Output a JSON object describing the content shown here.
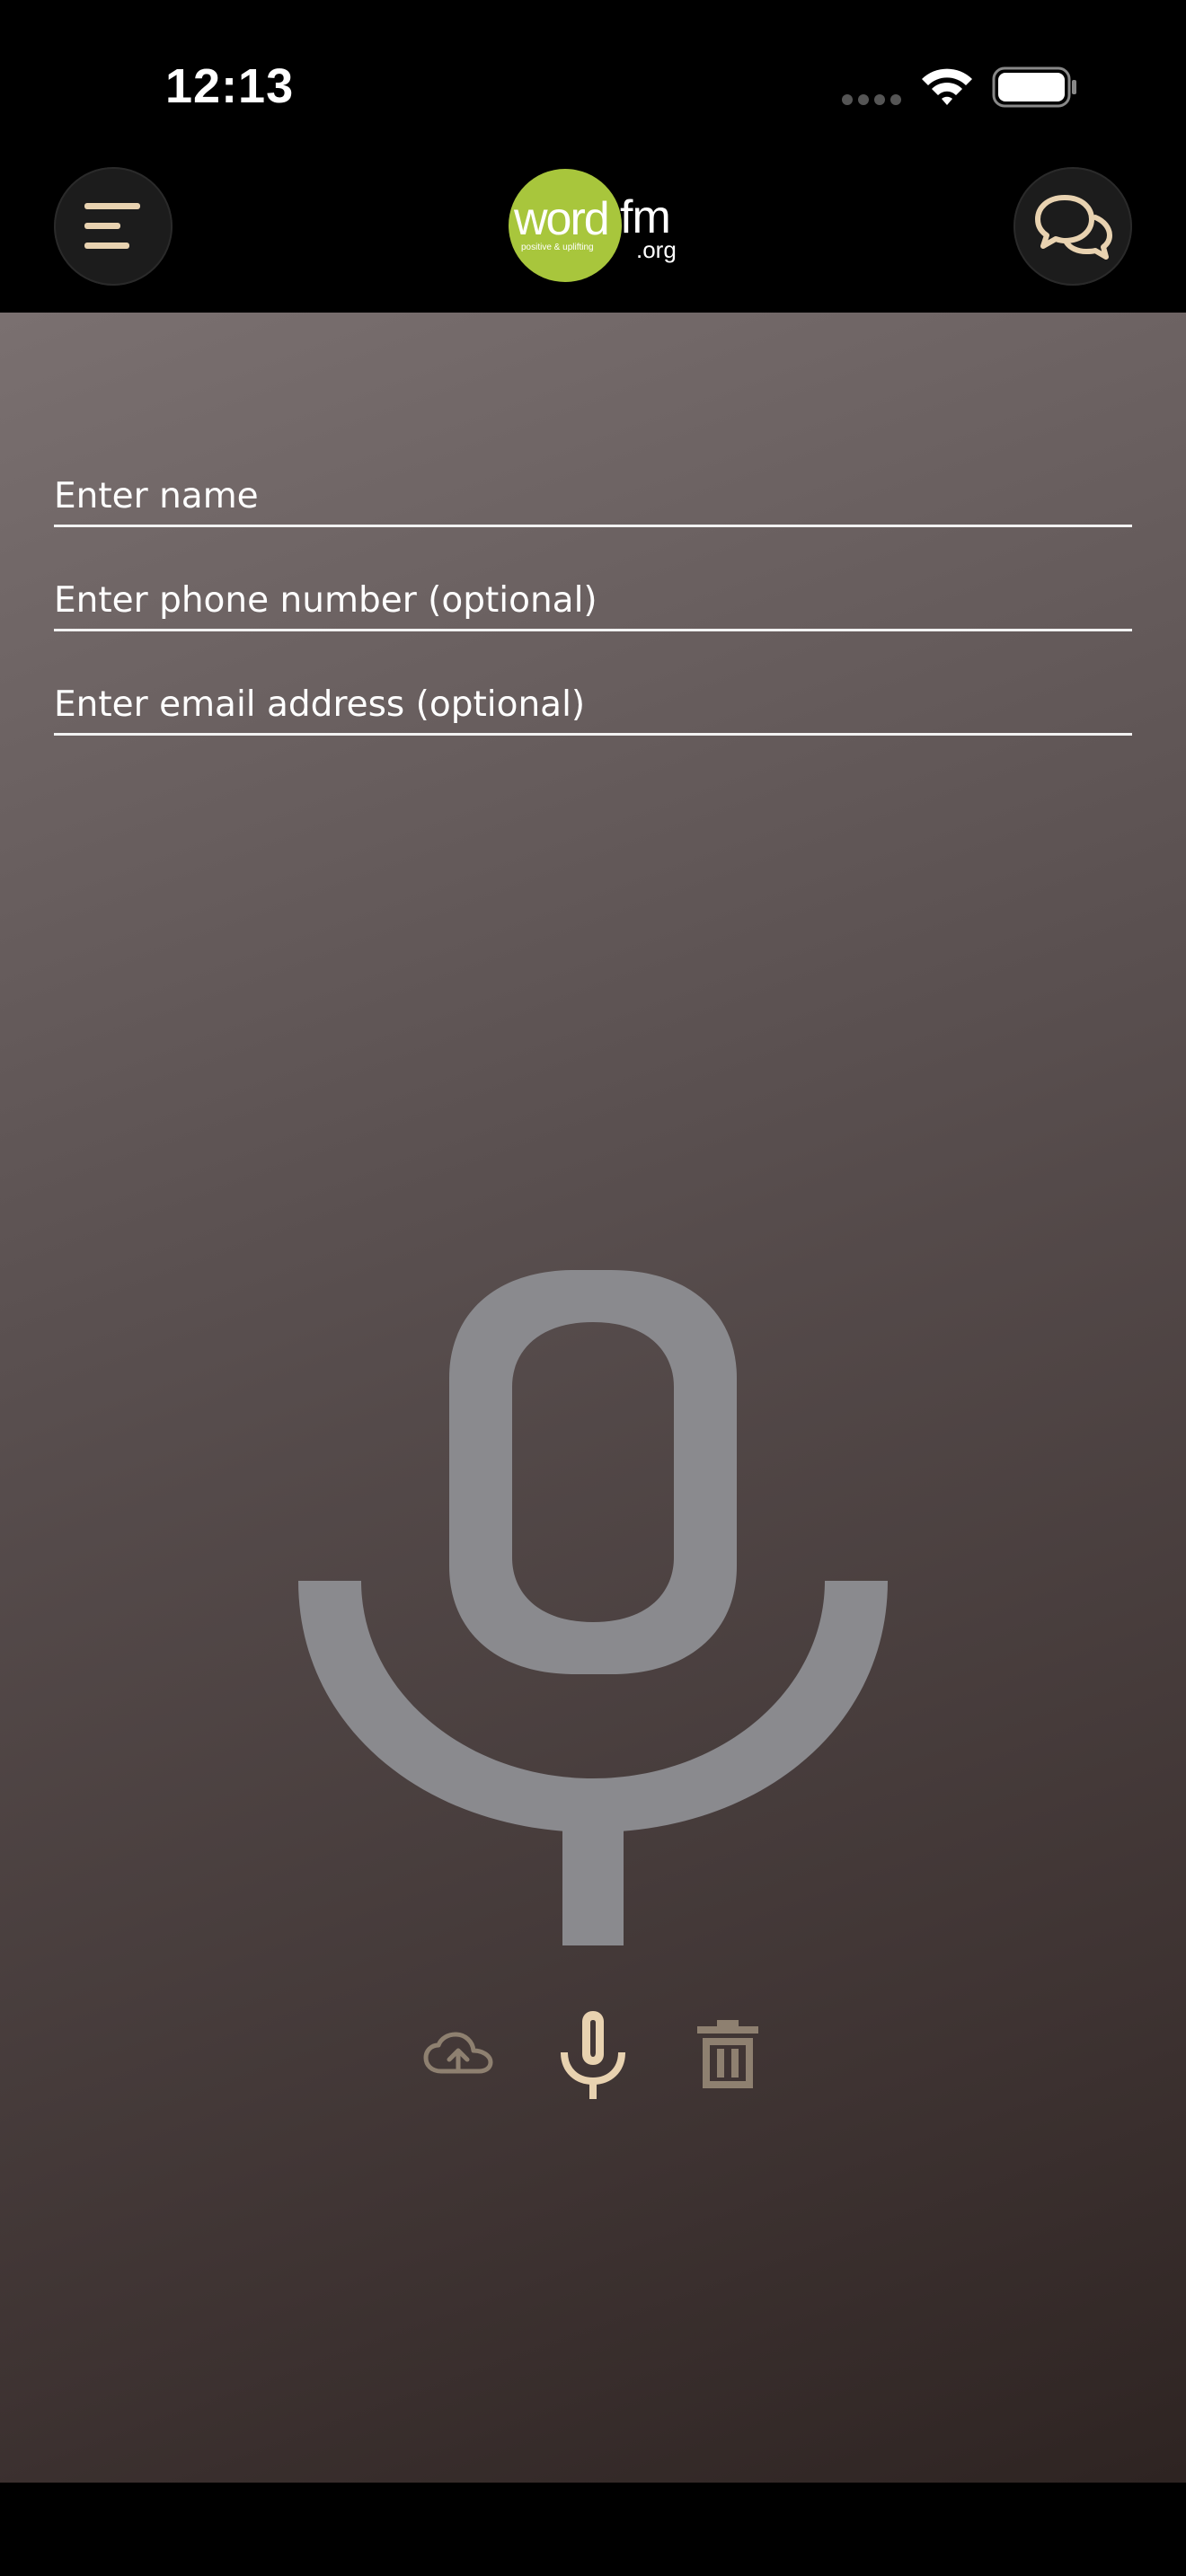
{
  "status_bar": {
    "time": "12:13"
  },
  "header": {
    "logo": {
      "word": "word",
      "fm": "fm",
      "org": ".org",
      "tagline": "positive & uplifting"
    },
    "menu_icon": "menu-lines-icon",
    "chat_icon": "chat-bubbles-icon"
  },
  "form": {
    "name_placeholder": "Enter name",
    "phone_placeholder": "Enter phone number (optional)",
    "email_placeholder": "Enter email address (optional)",
    "name_value": "",
    "phone_value": "",
    "email_value": ""
  },
  "recorder": {
    "large_icon": "microphone-icon",
    "upload_icon": "cloud-upload-icon",
    "record_icon": "microphone-icon",
    "delete_icon": "trash-icon"
  },
  "colors": {
    "accent": "#e8d2b0",
    "logo_green": "#a8c63c",
    "mic_gray": "#8a8a8e",
    "control_muted": "#8e8070"
  }
}
